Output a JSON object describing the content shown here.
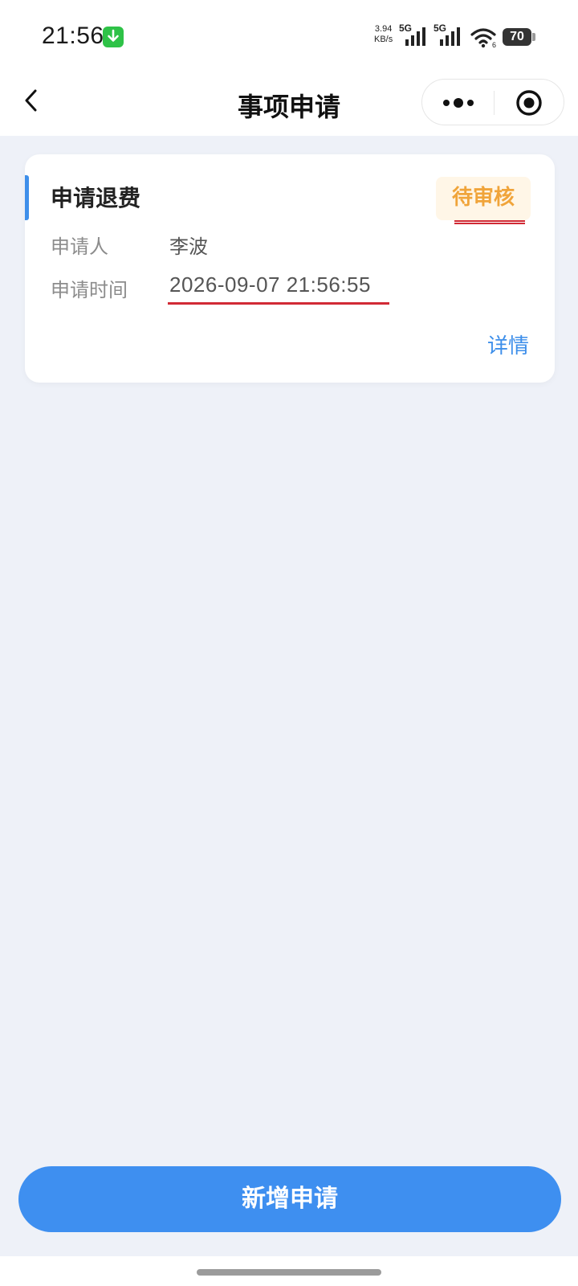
{
  "status_bar": {
    "time": "21:56",
    "net_speed_value": "3.94",
    "net_speed_unit": "KB/s",
    "signal_1_label": "5G",
    "signal_2_label": "5G",
    "wifi_label": "6",
    "battery": "70",
    "download_badge_color": "#2ec247"
  },
  "nav": {
    "title": "事项申请",
    "back_icon": "chevron-left-icon",
    "more_icon": "more-dots-icon",
    "close_icon": "target-circle-icon"
  },
  "card": {
    "title": "申请退费",
    "status": "待审核",
    "applicant_label": "申请人",
    "applicant_value": "李波",
    "time_label": "申请时间",
    "time_value": "2026-09-07 21:56:55",
    "detail_link": "详情",
    "accent_color": "#3e8fea",
    "status_color": "#f0a43a"
  },
  "footer": {
    "add_button_label": "新增申请",
    "button_color": "#3e8ff0"
  }
}
